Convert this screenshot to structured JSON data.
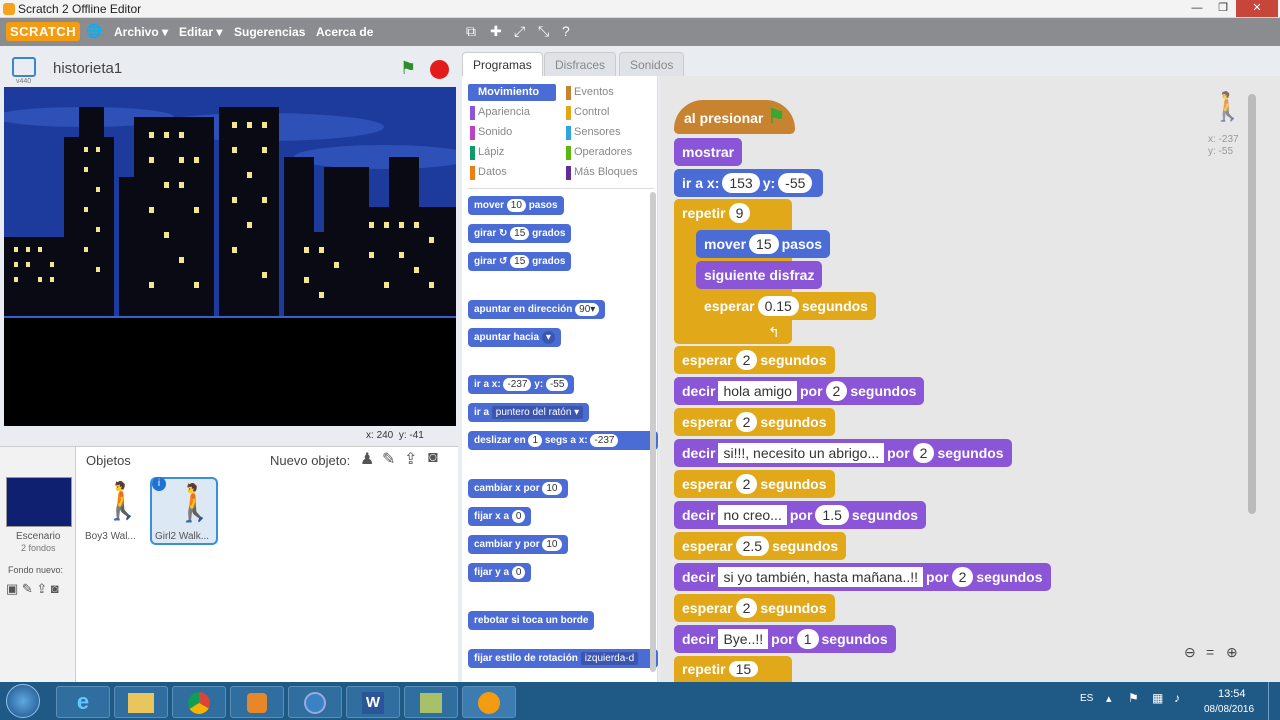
{
  "window": {
    "title": "Scratch 2 Offline Editor",
    "min": "—",
    "max": "❐",
    "close": "✕"
  },
  "menu": {
    "logo": "SCRATCH",
    "items": [
      "Archivo ▾",
      "Editar ▾",
      "Sugerencias",
      "Acerca de"
    ]
  },
  "stage": {
    "project_name": "historieta1",
    "version": "v440",
    "coords_x_label": "x:",
    "coords_x": "240",
    "coords_y_label": "y:",
    "coords_y": "-41"
  },
  "sprites": {
    "header": "Objetos",
    "new_sprite_label": "Nuevo objeto:",
    "stage_label": "Escenario",
    "stage_sub": "2 fondos",
    "new_backdrop_label": "Fondo nuevo:",
    "items": [
      "Boy3 Wal...",
      "Girl2 Walk..."
    ]
  },
  "tabs": [
    "Programas",
    "Disfraces",
    "Sonidos"
  ],
  "categories": [
    {
      "label": "Movimiento",
      "color": "#4a6cd4"
    },
    {
      "label": "Eventos",
      "color": "#c88330"
    },
    {
      "label": "Apariencia",
      "color": "#8a55d7"
    },
    {
      "label": "Control",
      "color": "#e1a91a"
    },
    {
      "label": "Sonido",
      "color": "#bb42c3"
    },
    {
      "label": "Sensores",
      "color": "#2ca5e2"
    },
    {
      "label": "Lápiz",
      "color": "#0e9a6c"
    },
    {
      "label": "Operadores",
      "color": "#5cb712"
    },
    {
      "label": "Datos",
      "color": "#ee7d16"
    },
    {
      "label": "Más Bloques",
      "color": "#632d99"
    }
  ],
  "palette": {
    "move": [
      "mover",
      "10",
      "pasos"
    ],
    "turn_r": [
      "girar ↻",
      "15",
      "grados"
    ],
    "turn_l": [
      "girar ↺",
      "15",
      "grados"
    ],
    "point_dir": [
      "apuntar en dirección",
      "90▾"
    ],
    "point_to": [
      "apuntar hacia",
      "▾"
    ],
    "goto_xy": [
      "ir a x:",
      "-237",
      "y:",
      "-55"
    ],
    "goto": [
      "ir a",
      "puntero del ratón ▾"
    ],
    "glide": [
      "deslizar en",
      "1",
      "segs a x:",
      "-237"
    ],
    "change_x": [
      "cambiar x por",
      "10"
    ],
    "set_x": [
      "fijar x a",
      "0"
    ],
    "change_y": [
      "cambiar y por",
      "10"
    ],
    "set_y": [
      "fijar y a",
      "0"
    ],
    "bounce": "rebotar si toca un borde",
    "rotation": [
      "fijar estilo de rotación",
      "izquierda-d"
    ]
  },
  "script": {
    "hat": "al presionar",
    "show": "mostrar",
    "goto": [
      "ir a x:",
      "153",
      "y:",
      "-55"
    ],
    "repeat1": [
      "repetir",
      "9"
    ],
    "move": [
      "mover",
      "15",
      "pasos"
    ],
    "next": "siguiente disfraz",
    "wait1": [
      "esperar",
      "0.15",
      "segundos"
    ],
    "wait2": [
      "esperar",
      "2",
      "segundos"
    ],
    "say1": [
      "decir",
      "hola amigo",
      "por",
      "2",
      "segundos"
    ],
    "wait3": [
      "esperar",
      "2",
      "segundos"
    ],
    "say2": [
      "decir",
      "si!!!, necesito un abrigo...",
      "por",
      "2",
      "segundos"
    ],
    "wait4": [
      "esperar",
      "2",
      "segundos"
    ],
    "say3": [
      "decir",
      "no creo...",
      "por",
      "1.5",
      "segundos"
    ],
    "wait5": [
      "esperar",
      "2.5",
      "segundos"
    ],
    "say4": [
      "decir",
      "si yo también, hasta mañana..!!",
      "por",
      "2",
      "segundos"
    ],
    "wait6": [
      "esperar",
      "2",
      "segundos"
    ],
    "say5": [
      "decir",
      "Bye..!!",
      "por",
      "1",
      "segundos"
    ],
    "repeat2": [
      "repetir",
      "15"
    ],
    "sprite_x": "x: -237",
    "sprite_y": "y: -55"
  },
  "taskbar": {
    "lang": "ES",
    "time": "13:54",
    "date": "08/08/2016"
  }
}
